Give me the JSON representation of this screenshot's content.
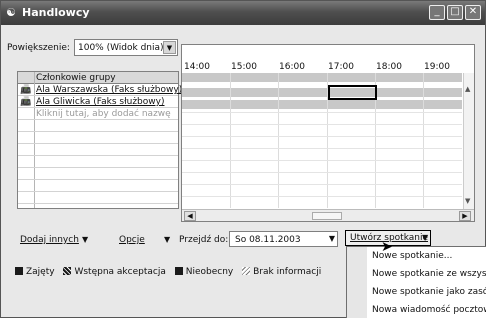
{
  "window": {
    "title": "Handlowcy"
  },
  "zoom": {
    "label": "Powiększenie:",
    "value": "100% (Widok dnia)"
  },
  "members": {
    "header": "Członkowie grupy",
    "items": [
      {
        "name": "Ala Warszawska (Faks służbowy)"
      },
      {
        "name": "Ala Gliwicka (Faks służbowy)"
      }
    ],
    "add_hint": "Kliknij tutaj, aby dodać nazwę"
  },
  "timeline": {
    "hours": [
      "14:00",
      "15:00",
      "16:00",
      "17:00",
      "18:00",
      "19:00"
    ]
  },
  "toolbar": {
    "add_others": "Dodaj innych",
    "options": "Opcje",
    "goto_label": "Przejdź do:",
    "date_value": "So 08.11.2003",
    "make_meeting": "Utwórz spotkanie"
  },
  "legend": {
    "busy": "Zajęty",
    "tentative": "Wstępna akceptacja",
    "absent": "Nieobecny",
    "no_info": "Brak informacji"
  },
  "menu": {
    "items": [
      "Nowe spotkanie...",
      "Nowe spotkanie ze wszystkimi",
      "Nowe spotkanie jako zasób...",
      "Nowa wiadomość pocztowa..."
    ]
  }
}
